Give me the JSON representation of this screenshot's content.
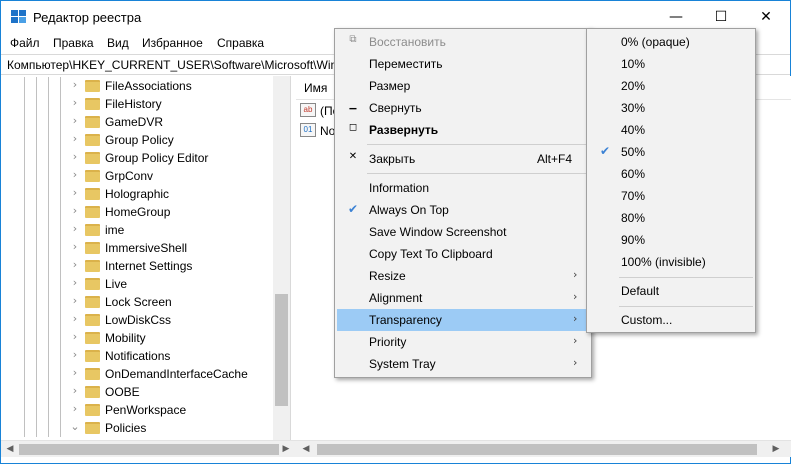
{
  "window": {
    "title": "Редактор реестра",
    "buttons": {
      "minimize": "—",
      "maximize": "☐",
      "close": "✕"
    }
  },
  "menubar": [
    "Файл",
    "Правка",
    "Вид",
    "Избранное",
    "Справка"
  ],
  "address": "Компьютер\\HKEY_CURRENT_USER\\Software\\Microsoft\\Wind",
  "tree": {
    "items": [
      {
        "label": "FileAssociations",
        "expanded": false
      },
      {
        "label": "FileHistory",
        "expanded": false
      },
      {
        "label": "GameDVR",
        "expanded": false
      },
      {
        "label": "Group Policy",
        "expanded": false
      },
      {
        "label": "Group Policy Editor",
        "expanded": false
      },
      {
        "label": "GrpConv",
        "expanded": false
      },
      {
        "label": "Holographic",
        "expanded": false
      },
      {
        "label": "HomeGroup",
        "expanded": false
      },
      {
        "label": "ime",
        "expanded": false
      },
      {
        "label": "ImmersiveShell",
        "expanded": false
      },
      {
        "label": "Internet Settings",
        "expanded": false
      },
      {
        "label": "Live",
        "expanded": false
      },
      {
        "label": "Lock Screen",
        "expanded": false
      },
      {
        "label": "LowDiskCss",
        "expanded": false
      },
      {
        "label": "Mobility",
        "expanded": false
      },
      {
        "label": "Notifications",
        "expanded": false
      },
      {
        "label": "OnDemandInterfaceCache",
        "expanded": false
      },
      {
        "label": "OOBE",
        "expanded": false
      },
      {
        "label": "PenWorkspace",
        "expanded": false
      },
      {
        "label": "Policies",
        "expanded": true
      }
    ]
  },
  "values_pane": {
    "column_name": "Имя",
    "rows": [
      {
        "label": "(По",
        "icon": "string-value-icon",
        "icon_text": "ab"
      },
      {
        "label": "No",
        "icon": "binary-value-icon",
        "icon_text": "01"
      }
    ]
  },
  "context_menu": {
    "items": [
      {
        "label": "Восстановить",
        "icon": "restore-icon",
        "glyph": "⧉",
        "disabled": true
      },
      {
        "label": "Переместить"
      },
      {
        "label": "Размер"
      },
      {
        "label": "Свернуть",
        "icon": "minimize-icon",
        "glyph": "▁"
      },
      {
        "label": "Развернуть",
        "icon": "maximize-icon",
        "glyph": "◻",
        "bold": true
      },
      {
        "label": "Закрыть",
        "icon": "close-icon",
        "glyph": "✕",
        "shortcut": "Alt+F4"
      },
      {
        "label": "Information"
      },
      {
        "label": "Always On Top",
        "icon": "checkmark-icon",
        "glyph": "✔",
        "checked": true
      },
      {
        "label": "Save Window Screenshot"
      },
      {
        "label": "Copy Text To Clipboard"
      },
      {
        "label": "Resize",
        "submenu": true
      },
      {
        "label": "Alignment",
        "submenu": true
      },
      {
        "label": "Transparency",
        "submenu": true,
        "highlighted": true
      },
      {
        "label": "Priority",
        "submenu": true
      },
      {
        "label": "System Tray",
        "submenu": true
      }
    ],
    "submenu_arrow": "›"
  },
  "transparency_menu": {
    "items": [
      {
        "label": "0% (opaque)"
      },
      {
        "label": "10%"
      },
      {
        "label": "20%"
      },
      {
        "label": "30%"
      },
      {
        "label": "40%"
      },
      {
        "label": "50%",
        "checked": true
      },
      {
        "label": "60%"
      },
      {
        "label": "70%"
      },
      {
        "label": "80%"
      },
      {
        "label": "90%"
      },
      {
        "label": "100% (invisible)"
      },
      {
        "label": "Default"
      },
      {
        "label": "Custom..."
      }
    ],
    "check_glyph": "✔"
  },
  "colors": {
    "highlight": "#9ccbf5",
    "menu_bg": "#f2f2f2",
    "folder": "#e8c763",
    "window_border": "#1883d7",
    "check": "#3c82d4"
  }
}
